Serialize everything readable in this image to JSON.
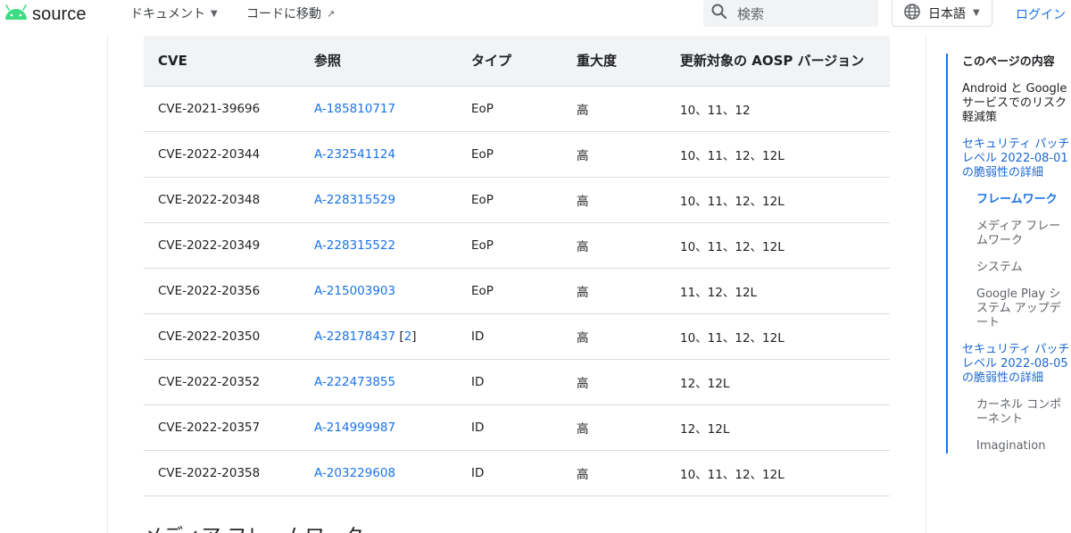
{
  "header": {
    "logo_text": "source",
    "nav_docs": "ドキュメント",
    "nav_code": "コードに移動",
    "search_placeholder": "検索",
    "language": "日本語",
    "login": "ログイン"
  },
  "table": {
    "headers": [
      "CVE",
      "参照",
      "タイプ",
      "重大度",
      "更新対象の AOSP バージョン"
    ],
    "rows": [
      {
        "cve": "CVE-2021-39696",
        "ref": "A-185810717",
        "extra": "",
        "type": "EoP",
        "severity": "高",
        "versions": "10、11、12"
      },
      {
        "cve": "CVE-2022-20344",
        "ref": "A-232541124",
        "extra": "",
        "type": "EoP",
        "severity": "高",
        "versions": "10、11、12、12L"
      },
      {
        "cve": "CVE-2022-20348",
        "ref": "A-228315529",
        "extra": "",
        "type": "EoP",
        "severity": "高",
        "versions": "10、11、12、12L"
      },
      {
        "cve": "CVE-2022-20349",
        "ref": "A-228315522",
        "extra": "",
        "type": "EoP",
        "severity": "高",
        "versions": "10、11、12、12L"
      },
      {
        "cve": "CVE-2022-20356",
        "ref": "A-215003903",
        "extra": "",
        "type": "EoP",
        "severity": "高",
        "versions": "11、12、12L"
      },
      {
        "cve": "CVE-2022-20350",
        "ref": "A-228178437",
        "extra": "2",
        "type": "ID",
        "severity": "高",
        "versions": "10、11、12、12L"
      },
      {
        "cve": "CVE-2022-20352",
        "ref": "A-222473855",
        "extra": "",
        "type": "ID",
        "severity": "高",
        "versions": "12、12L"
      },
      {
        "cve": "CVE-2022-20357",
        "ref": "A-214999987",
        "extra": "",
        "type": "ID",
        "severity": "高",
        "versions": "12、12L"
      },
      {
        "cve": "CVE-2022-20358",
        "ref": "A-203229608",
        "extra": "",
        "type": "ID",
        "severity": "高",
        "versions": "10、11、12、12L"
      }
    ]
  },
  "next_heading": "メディア フレームワーク",
  "toc": {
    "title": "このページの内容",
    "items": [
      {
        "label": "Android と Google サービスでのリスク軽減策",
        "level": 1,
        "state": "normal"
      },
      {
        "label": "セキュリティ パッチレベル 2022-08-01 の脆弱性の詳細",
        "level": 1,
        "state": "blue"
      },
      {
        "label": "フレームワーク",
        "level": 2,
        "state": "active"
      },
      {
        "label": "メディア フレームワーク",
        "level": 2,
        "state": "normal"
      },
      {
        "label": "システム",
        "level": 2,
        "state": "normal"
      },
      {
        "label": "Google Play システム アップデート",
        "level": 2,
        "state": "normal"
      },
      {
        "label": "セキュリティ パッチレベル 2022-08-05 の脆弱性の詳細",
        "level": 1,
        "state": "blue"
      },
      {
        "label": "カーネル コンポーネント",
        "level": 2,
        "state": "normal"
      },
      {
        "label": "Imagination",
        "level": 2,
        "state": "normal"
      }
    ]
  },
  "colors": {
    "link": "#1a73e8",
    "header_bg": "#f1f3f4",
    "android_green": "#3ddc84"
  }
}
